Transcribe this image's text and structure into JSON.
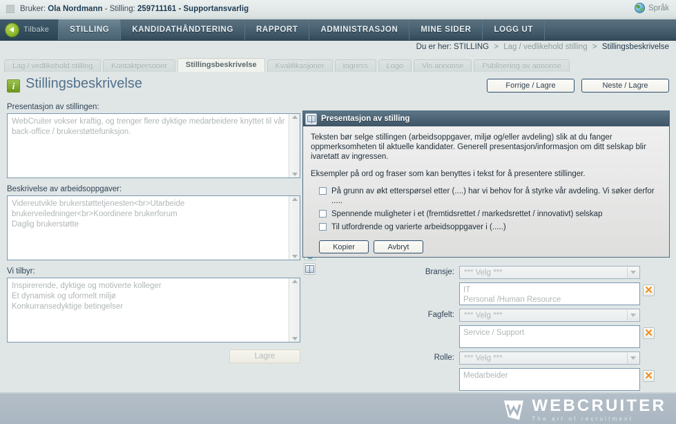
{
  "userbar": {
    "prefix": "Bruker: ",
    "user": "Ola Nordmann",
    "mid": " - Stilling: ",
    "job_id": "259711161",
    "suffix": " - Supportansvarlig",
    "language_label": "Språk"
  },
  "nav": {
    "back_label": "Tilbake",
    "items": [
      {
        "label": "STILLING",
        "active": true
      },
      {
        "label": "KANDIDATHÅNDTERING",
        "active": false
      },
      {
        "label": "RAPPORT",
        "active": false
      },
      {
        "label": "ADMINISTRASJON",
        "active": false
      },
      {
        "label": "MINE SIDER",
        "active": false
      },
      {
        "label": "LOGG UT",
        "active": false
      }
    ]
  },
  "breadcrumb": {
    "prefix": "Du er her: STILLING",
    "sep1": ">",
    "link": "Lag / vedlikehold stilling",
    "sep2": ">",
    "current": "Stillingsbeskrivelse"
  },
  "tabs": [
    {
      "label": "Lag / vedlikehold stilling",
      "active": false
    },
    {
      "label": "Kontaktpersoner",
      "active": false
    },
    {
      "label": "Stillingsbeskrivelse",
      "active": true
    },
    {
      "label": "Kvalifikasjoner",
      "active": false
    },
    {
      "label": "Ingress",
      "active": false
    },
    {
      "label": "Logo",
      "active": false
    },
    {
      "label": "Vis annonse",
      "active": false
    },
    {
      "label": "Publisering av annonse",
      "active": false
    }
  ],
  "page": {
    "title": "Stillingsbeskrivelse",
    "info_icon_glyph": "i",
    "prev_save_label": "Forrige / Lagre",
    "next_save_label": "Neste / Lagre"
  },
  "left": {
    "field1_label": "Presentasjon av stillingen:",
    "field1_value": "WebCruiter vokser kraftig, og trenger flere dyktige medarbeidere knyttet til vår back-office / brukerstøttefunksjon.",
    "field2_label": "Beskrivelse av arbeidsoppgaver:",
    "field2_value": "Videreutvikle brukerstøttetjenesten<br>Utarbeide brukerveiledninger<br>Koordinere brukerforum\nDaglig brukerstøtte",
    "field3_label": "Vi tilbyr:",
    "field3_value": "Inspirerende, dyktige og motiverte kolleger\nEt dynamisk og uformelt miljø\nKonkurransedyktige betingelser",
    "save_label": "Lagre"
  },
  "infopanel": {
    "title": "Presentasjon av stilling",
    "paragraph1": "Teksten bør selge stillingen (arbeidsoppgaver, miljø og/eller avdeling) slik at du fanger oppmerksomheten til aktuelle kandidater. Generell presentasjon/informasjon om ditt selskap blir ivaretatt av ingressen.",
    "paragraph2": "Eksempler på ord og fraser som kan benyttes i tekst for å presentere stillinger.",
    "phrases": [
      {
        "text": "På grunn av økt etterspørsel etter (....) har vi behov for å styrke vår avdeling. Vi søker derfor .....",
        "checked": false
      },
      {
        "text": "Spennende muligheter i et (fremtidsrettet / markedsrettet / innovativt) selskap",
        "checked": false
      },
      {
        "text": "Til utfordrende og varierte arbeidsoppgaver i (.....)",
        "checked": false
      }
    ],
    "copy_label": "Kopier",
    "cancel_label": "Avbryt"
  },
  "rightform": {
    "select_placeholder": "*** Velg ***",
    "clear_glyph": "✕",
    "rows": [
      {
        "label": "Bransje:",
        "selected": "*** Velg ***",
        "values": [
          "IT",
          "Personal /Human Resource"
        ]
      },
      {
        "label": "Fagfelt:",
        "selected": "*** Velg ***",
        "values": [
          "Service / Support"
        ]
      },
      {
        "label": "Rolle:",
        "selected": "*** Velg ***",
        "values": [
          "Medarbeider"
        ]
      }
    ]
  },
  "footer": {
    "brand": "WEBCRUITER",
    "tagline": "The art of recruitment"
  }
}
